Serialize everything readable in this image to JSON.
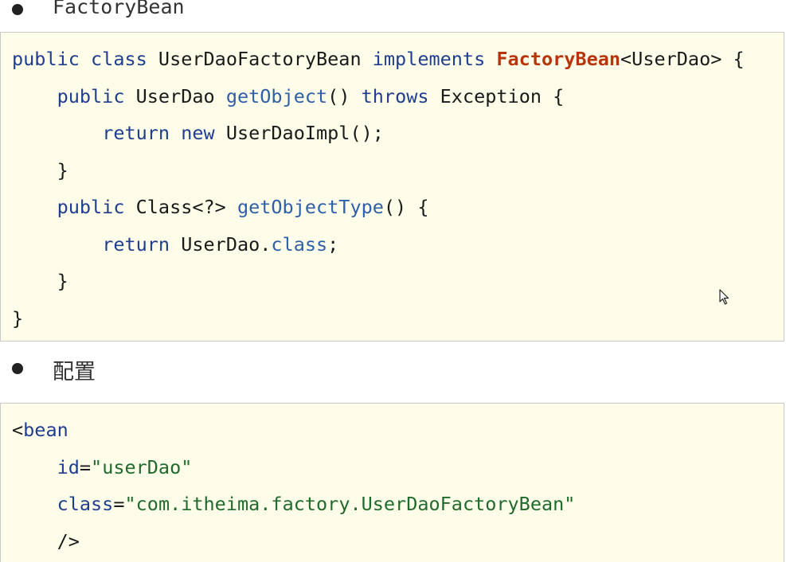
{
  "sections": [
    {
      "bullet": "FactoryBean",
      "code_lines": [
        [
          {
            "t": "public class",
            "c": "kw"
          },
          {
            "t": " UserDaoFactoryBean ",
            "c": "plain"
          },
          {
            "t": "implements",
            "c": "kw"
          },
          {
            "t": " ",
            "c": "plain"
          },
          {
            "t": "FactoryBean",
            "c": "type-hl"
          },
          {
            "t": "<UserDao> {",
            "c": "plain"
          }
        ],
        [
          {
            "t": "    ",
            "c": "plain"
          },
          {
            "t": "public",
            "c": "kw"
          },
          {
            "t": " UserDao ",
            "c": "plain"
          },
          {
            "t": "getObject",
            "c": "fn"
          },
          {
            "t": "() ",
            "c": "plain"
          },
          {
            "t": "throws",
            "c": "kw"
          },
          {
            "t": " Exception {",
            "c": "plain"
          }
        ],
        [
          {
            "t": "        ",
            "c": "plain"
          },
          {
            "t": "return new",
            "c": "kw"
          },
          {
            "t": " UserDaoImpl();",
            "c": "plain"
          }
        ],
        [
          {
            "t": "    }",
            "c": "plain"
          }
        ],
        [
          {
            "t": "    ",
            "c": "plain"
          },
          {
            "t": "public",
            "c": "kw"
          },
          {
            "t": " Class<?> ",
            "c": "plain"
          },
          {
            "t": "getObjectType",
            "c": "fn"
          },
          {
            "t": "() {",
            "c": "plain"
          }
        ],
        [
          {
            "t": "        ",
            "c": "plain"
          },
          {
            "t": "return",
            "c": "kw"
          },
          {
            "t": " UserDao.",
            "c": "plain"
          },
          {
            "t": "class",
            "c": "fn"
          },
          {
            "t": ";",
            "c": "plain"
          }
        ],
        [
          {
            "t": "    }",
            "c": "plain"
          }
        ],
        [
          {
            "t": "}",
            "c": "plain"
          }
        ]
      ]
    },
    {
      "bullet": "配置",
      "code_lines": [
        [
          {
            "t": "<",
            "c": "plain"
          },
          {
            "t": "bean",
            "c": "tag"
          }
        ],
        [
          {
            "t": "    ",
            "c": "plain"
          },
          {
            "t": "id",
            "c": "attr"
          },
          {
            "t": "=",
            "c": "plain"
          },
          {
            "t": "\"userDao\"",
            "c": "str"
          }
        ],
        [
          {
            "t": "    ",
            "c": "plain"
          },
          {
            "t": "class",
            "c": "attr"
          },
          {
            "t": "=",
            "c": "plain"
          },
          {
            "t": "\"com.itheima.factory.UserDaoFactoryBean\"",
            "c": "str"
          }
        ],
        [
          {
            "t": "    />",
            "c": "plain"
          }
        ]
      ]
    }
  ],
  "cursor_icon": "mouse-pointer-icon"
}
